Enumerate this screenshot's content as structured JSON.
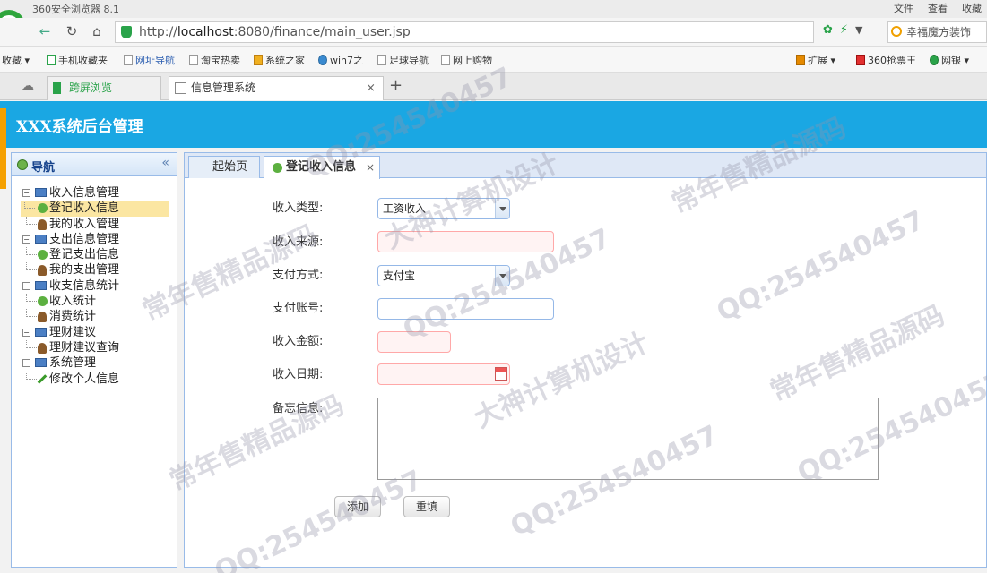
{
  "browser": {
    "app_title": "360安全浏览器 8.1",
    "menus": [
      "文件",
      "查看",
      "收藏"
    ],
    "url_prefix": "http://",
    "url_host": "localhost",
    "url_rest": ":8080/finance/main_user.jsp",
    "search_text": "幸福魔方装饰",
    "bookmarks": [
      "收藏",
      "手机收藏夹",
      "网址导航",
      "淘宝热卖",
      "系统之家",
      "win7之",
      "足球导航",
      "网上购物"
    ],
    "right_tools": [
      "扩展",
      "360抢票王",
      "网银"
    ],
    "tabs": [
      {
        "label": "跨屏浏览"
      },
      {
        "label": "信息管理系统"
      }
    ],
    "close_label": "×",
    "newtab_label": "+"
  },
  "app": {
    "title": "XXX系统后台管理"
  },
  "sidebar": {
    "title": "导航",
    "collapse": "«",
    "tree": [
      {
        "label": "收入信息管理",
        "children": [
          "登记收入信息",
          "我的收入管理"
        ]
      },
      {
        "label": "支出信息管理",
        "children": [
          "登记支出信息",
          "我的支出管理"
        ]
      },
      {
        "label": "收支信息统计",
        "children": [
          "收入统计",
          "消费统计"
        ]
      },
      {
        "label": "理财建议",
        "children": [
          "理财建议查询"
        ]
      },
      {
        "label": "系统管理",
        "children": [
          "修改个人信息"
        ]
      }
    ]
  },
  "content": {
    "tabs": [
      {
        "label": "起始页"
      },
      {
        "label": "登记收入信息",
        "close": "×"
      }
    ],
    "form": {
      "income_type_label": "收入类型:",
      "income_type_value": "工资收入",
      "income_source_label": "收入来源:",
      "pay_method_label": "支付方式:",
      "pay_method_value": "支付宝",
      "pay_account_label": "支付账号:",
      "amount_label": "收入金额:",
      "date_label": "收入日期:",
      "memo_label": "备忘信息:",
      "add_button": "添加",
      "reset_button": "重填"
    }
  },
  "watermarks": [
    "常年售精品源码",
    "QQ:254540457",
    "大神计算机设计"
  ]
}
